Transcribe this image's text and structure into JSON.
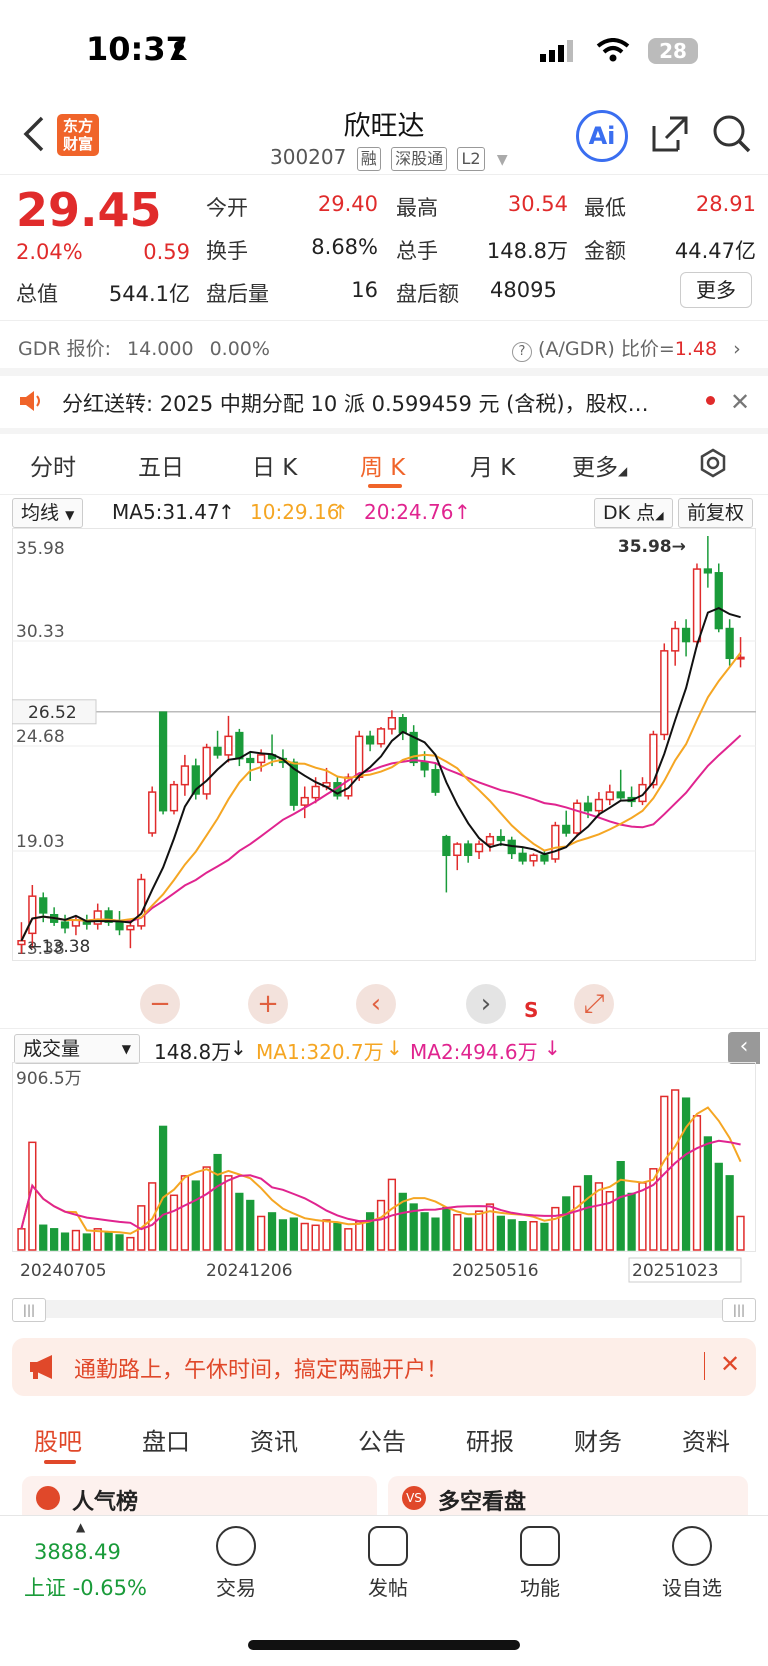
{
  "status_bar": {
    "time": "10:37",
    "battery": "28"
  },
  "header": {
    "title": "欣旺达",
    "code": "300207",
    "tags": [
      "融",
      "深股通",
      "L2"
    ],
    "logo_line1": "东方",
    "logo_line2": "财富"
  },
  "quote": {
    "price": "29.45",
    "pct": "2.04%",
    "change": "0.59",
    "open_label": "今开",
    "open": "29.40",
    "high_label": "最高",
    "high": "30.54",
    "low_label": "最低",
    "low": "28.91",
    "turnover_label": "换手",
    "turnover": "8.68%",
    "volume_label": "总手",
    "volume": "148.8万",
    "amount_label": "金额",
    "amount": "44.47亿",
    "mktcap_label": "总值",
    "mktcap": "544.1亿",
    "ah_vol_label": "盘后量",
    "ah_vol": "16",
    "ah_amt_label": "盘后额",
    "ah_amt": "48095",
    "more": "更多"
  },
  "gdr": {
    "label": "GDR 报价:",
    "price": "14.000",
    "pct": "0.00%",
    "ratio_label": "(A/GDR) 比价=",
    "ratio": "1.48"
  },
  "notice": {
    "label": "分红送转:",
    "text": "2025 中期分配 10 派 0.599459 元 (含税)，股权…"
  },
  "tabs": [
    "分时",
    "五日",
    "日 K",
    "周 K",
    "月 K",
    "更多"
  ],
  "active_tab": "周 K",
  "kline_controls": {
    "ma_select": "均线",
    "ma5": "MA5:31.47",
    "ma10": "10:29.16",
    "ma20": "20:24.76",
    "dk": "DK 点",
    "fq": "前复权"
  },
  "vol_controls": {
    "select": "成交量",
    "vol": "148.8万",
    "ma1": "MA1:320.7万",
    "ma2": "MA2:494.6万"
  },
  "colors": {
    "up": "#e02b2b",
    "down": "#1a9b3a",
    "ma5": "#111111",
    "ma10": "#f5a623",
    "ma20": "#e0248f",
    "accent": "#f0642a"
  },
  "chart_data": {
    "type": "candlestick",
    "y_ticks": [
      "35.98",
      "30.33",
      "24.68",
      "19.03",
      "13.38"
    ],
    "ylim": [
      13.38,
      35.98
    ],
    "current_line": "26.52",
    "max_label": "35.98",
    "min_label": "13.38",
    "vol_max_label": "906.5万",
    "vol_ylim": [
      0,
      906.5
    ],
    "x_labels": [
      "20240705",
      "20241206",
      "20250516",
      "20251023"
    ],
    "candles": [
      [
        14.0,
        15.2,
        13.5,
        14.2
      ],
      [
        14.6,
        17.2,
        13.8,
        16.6
      ],
      [
        16.5,
        16.8,
        15.2,
        15.7
      ],
      [
        15.6,
        16.0,
        15.0,
        15.2
      ],
      [
        15.2,
        15.6,
        14.6,
        14.9
      ],
      [
        15.0,
        15.5,
        14.5,
        15.3
      ],
      [
        15.3,
        15.6,
        14.8,
        15.1
      ],
      [
        15.1,
        16.2,
        14.8,
        15.8
      ],
      [
        15.8,
        16.0,
        15.0,
        15.2
      ],
      [
        15.2,
        15.8,
        14.5,
        14.8
      ],
      [
        14.8,
        15.4,
        13.8,
        15.0
      ],
      [
        15.0,
        17.8,
        14.8,
        17.5
      ],
      [
        20.0,
        22.5,
        19.8,
        22.2
      ],
      [
        26.5,
        26.5,
        21.0,
        21.2
      ],
      [
        21.2,
        22.8,
        21.0,
        22.6
      ],
      [
        22.6,
        24.2,
        22.0,
        23.6
      ],
      [
        23.6,
        24.0,
        21.8,
        22.1
      ],
      [
        22.1,
        24.8,
        21.8,
        24.6
      ],
      [
        24.6,
        25.5,
        24.0,
        24.2
      ],
      [
        24.2,
        26.3,
        23.8,
        25.2
      ],
      [
        25.4,
        25.6,
        23.6,
        24.0
      ],
      [
        24.0,
        24.3,
        22.8,
        23.8
      ],
      [
        23.8,
        24.5,
        23.3,
        24.2
      ],
      [
        24.2,
        25.3,
        23.6,
        24.0
      ],
      [
        24.0,
        24.5,
        23.5,
        23.8
      ],
      [
        23.8,
        24.0,
        21.2,
        21.5
      ],
      [
        21.5,
        22.5,
        20.8,
        21.9
      ],
      [
        21.9,
        23.0,
        21.6,
        22.5
      ],
      [
        22.5,
        23.5,
        22.3,
        22.7
      ],
      [
        22.7,
        23.0,
        21.8,
        22.0
      ],
      [
        22.0,
        23.2,
        21.8,
        23.0
      ],
      [
        23.0,
        25.5,
        22.8,
        25.2
      ],
      [
        25.2,
        25.5,
        24.4,
        24.8
      ],
      [
        24.8,
        25.7,
        24.6,
        25.6
      ],
      [
        25.6,
        26.6,
        25.3,
        26.2
      ],
      [
        26.2,
        26.4,
        25.0,
        25.4
      ],
      [
        25.4,
        25.8,
        23.6,
        23.8
      ],
      [
        23.8,
        24.4,
        23.0,
        23.4
      ],
      [
        23.4,
        23.8,
        22.0,
        22.2
      ],
      [
        19.8,
        19.9,
        16.8,
        18.8
      ],
      [
        18.8,
        19.5,
        18.0,
        19.4
      ],
      [
        19.4,
        19.6,
        18.4,
        18.8
      ],
      [
        19.0,
        19.6,
        18.6,
        19.4
      ],
      [
        19.4,
        20.0,
        19.0,
        19.8
      ],
      [
        19.8,
        20.2,
        19.3,
        19.6
      ],
      [
        19.6,
        19.8,
        18.6,
        18.9
      ],
      [
        18.9,
        19.2,
        18.3,
        18.5
      ],
      [
        18.5,
        18.9,
        18.2,
        18.8
      ],
      [
        18.8,
        19.1,
        18.3,
        18.5
      ],
      [
        18.6,
        20.6,
        18.4,
        20.4
      ],
      [
        20.4,
        21.2,
        19.8,
        20.0
      ],
      [
        20.0,
        21.8,
        19.8,
        21.6
      ],
      [
        21.6,
        22.0,
        20.8,
        21.2
      ],
      [
        21.2,
        22.2,
        20.9,
        21.8
      ],
      [
        21.8,
        22.6,
        21.5,
        22.2
      ],
      [
        22.2,
        23.4,
        21.8,
        21.9
      ],
      [
        21.9,
        22.5,
        21.4,
        21.7
      ],
      [
        21.7,
        23.0,
        21.5,
        22.6
      ],
      [
        22.6,
        25.5,
        22.4,
        25.3
      ],
      [
        25.3,
        30.2,
        25.0,
        29.8
      ],
      [
        29.8,
        31.4,
        29.0,
        31.0
      ],
      [
        31.0,
        31.5,
        29.5,
        30.3
      ],
      [
        30.3,
        34.5,
        30.0,
        34.2
      ],
      [
        34.2,
        35.98,
        33.2,
        34.0
      ],
      [
        34.0,
        34.5,
        30.8,
        31.0
      ],
      [
        31.0,
        31.5,
        29.0,
        29.4
      ],
      [
        29.4,
        30.54,
        28.91,
        29.45
      ]
    ],
    "volumes": [
      120,
      610,
      140,
      120,
      95,
      110,
      90,
      120,
      100,
      85,
      70,
      250,
      380,
      700,
      310,
      420,
      390,
      470,
      540,
      420,
      320,
      280,
      190,
      210,
      170,
      180,
      150,
      140,
      170,
      150,
      120,
      160,
      210,
      280,
      400,
      320,
      260,
      210,
      180,
      240,
      200,
      180,
      220,
      260,
      190,
      170,
      160,
      160,
      150,
      240,
      300,
      360,
      420,
      380,
      330,
      500,
      320,
      380,
      460,
      870,
      906.5,
      860,
      760,
      640,
      490,
      420,
      190
    ]
  },
  "promo": {
    "text": "通勤路上，午休时间，搞定两融开户！"
  },
  "bottom_tabs": [
    "股吧",
    "盘口",
    "资讯",
    "公告",
    "研报",
    "财务",
    "资料"
  ],
  "bottom_active": "股吧",
  "cards": [
    "人气榜",
    "多空看盘"
  ],
  "bottom_nav": {
    "index_value": "3888.49",
    "index_label": "上证 -0.65%",
    "items": [
      "交易",
      "发帖",
      "功能",
      "设自选"
    ]
  }
}
